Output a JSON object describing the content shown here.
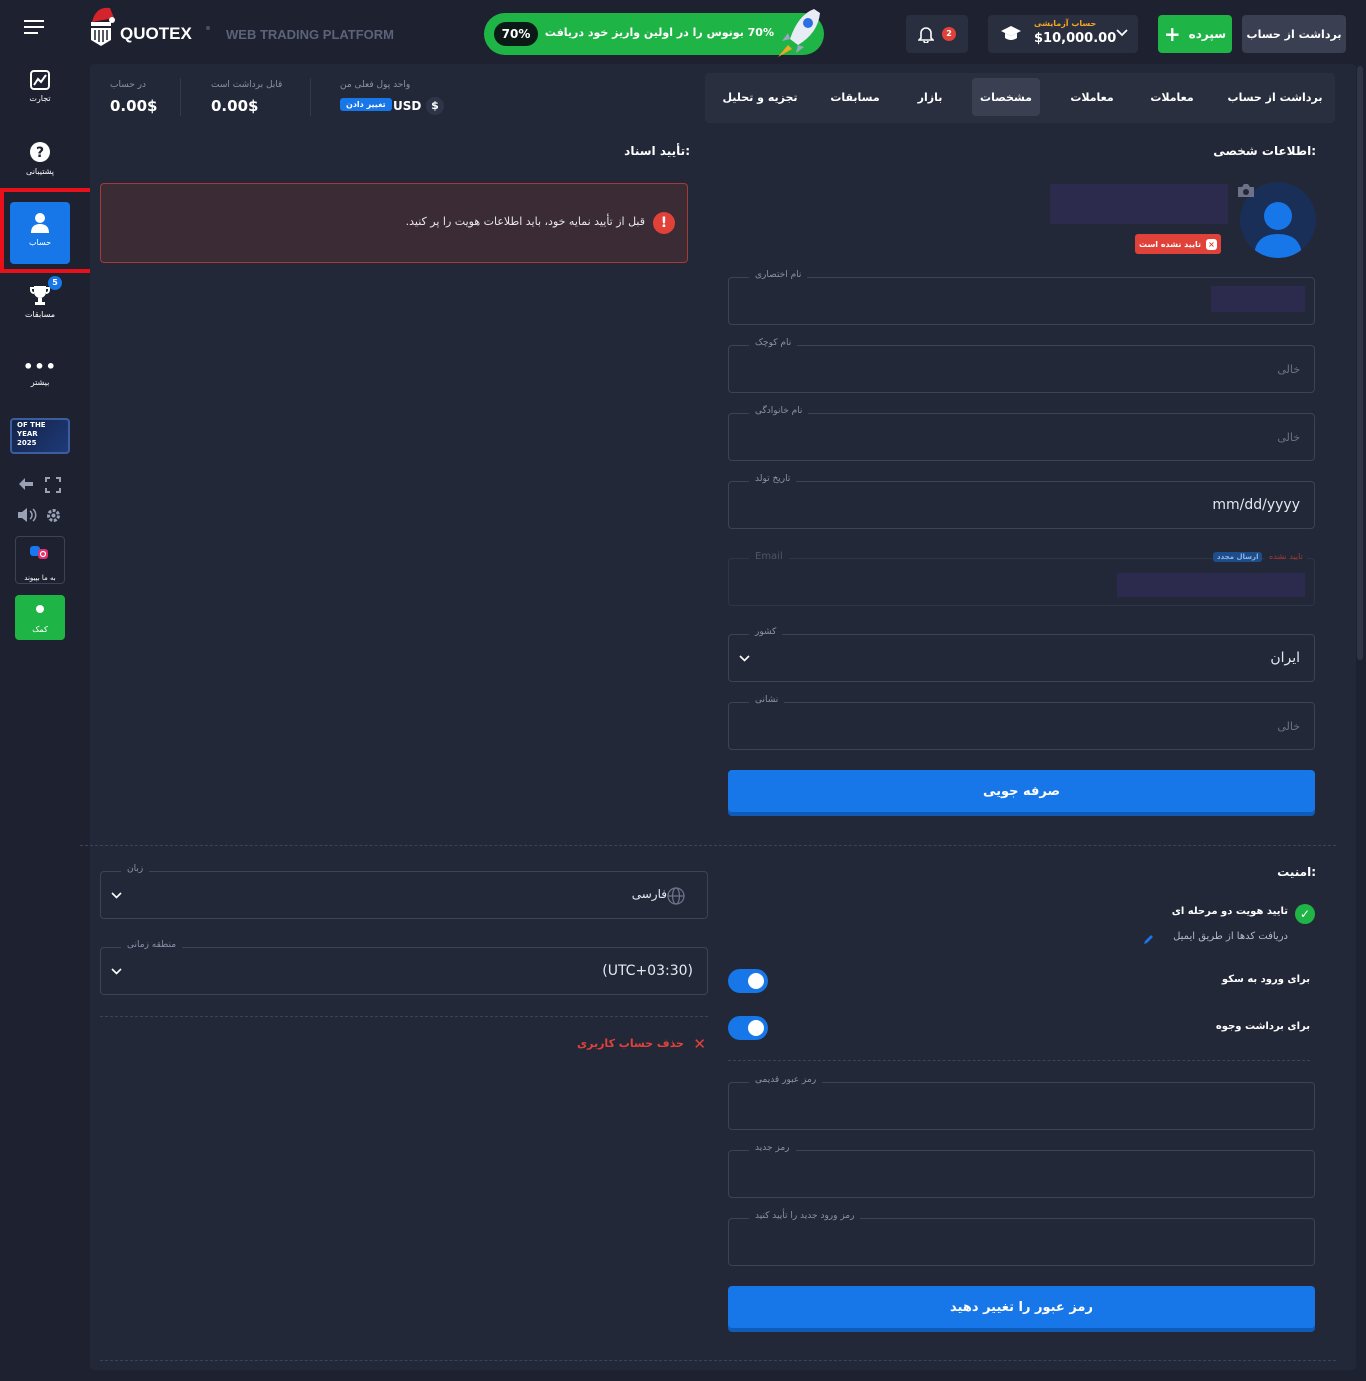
{
  "sidebar": {
    "items": [
      {
        "label": "تجارت",
        "icon": "chart-icon"
      },
      {
        "label": "پشتیبانی",
        "icon": "help-icon"
      },
      {
        "label": "حساب",
        "icon": "user-icon"
      },
      {
        "label": "مسابقات",
        "icon": "trophy-icon",
        "badge": "5"
      },
      {
        "label": "بیشتر",
        "icon": "more-icon"
      }
    ],
    "award_text": "OF THE YEAR 2025",
    "social_label": "به ما بپیوند",
    "help_label": "کمک"
  },
  "header": {
    "brand": "QUOTEX",
    "subtitle": "WEB TRADING PLATFORM",
    "promo_badge": "70%",
    "promo_text": "70% بونوس را در اولین واریز خود دریافت کنید!",
    "notifications_count": "2",
    "account_type": "حساب آزمایشی",
    "balance": "$10,000.00",
    "deposit_label": "سپرده",
    "withdraw_label": "برداشت از حساب"
  },
  "stats": {
    "in_account_label": "در حساب",
    "in_account_value": "0.00$",
    "withdrawable_label": "قابل برداشت است",
    "withdrawable_value": "0.00$",
    "currency_label": "واحد پول فعلی من",
    "currency_symbol": "$",
    "currency_code": "USD",
    "change_label": "تغییر دادن"
  },
  "tabs": [
    "برداشت از حساب",
    "معاملات",
    "معاملات",
    "مشخصات",
    "بازار",
    "مسابقات",
    "تجزیه و تحلیل"
  ],
  "active_tab": "مشخصات",
  "personal": {
    "title": "اطلاعات شخصی:",
    "unverified": "تایید نشده است",
    "nickname_label": "نام اختصاری",
    "first_name_label": "نام کوچک",
    "first_name_placeholder": "خالی",
    "last_name_label": "نام خانوادگی",
    "last_name_placeholder": "خالی",
    "dob_label": "تاریخ تولد",
    "dob_value": "mm/dd/yyyy",
    "email_label": "Email",
    "email_status": "تایید نشده",
    "email_resend": "ارسال مجدد",
    "country_label": "کشور",
    "country_value": "ایران",
    "address_label": "نشانی",
    "address_placeholder": "خالی",
    "save_label": "صرفه جویی"
  },
  "documents": {
    "title": "تأیید اسناد:",
    "warning": "قبل از تأیید نمایه خود، باید اطلاعات هویت را پر کنید."
  },
  "settings": {
    "language_label": "زبان",
    "language_value": "فارسی",
    "timezone_label": "منطقه زمانی",
    "timezone_value": "(UTC+03:30)",
    "delete_label": "حذف حساب کاربری"
  },
  "security": {
    "title": "امنیت:",
    "twofa_label": "تایید هویت دو مرحله ای",
    "twofa_sub": "دریافت کدها از طریق ایمیل",
    "login_label": "برای ورود به سکو",
    "withdraw_label": "برای برداشت وجوه",
    "old_pw_label": "رمز عبور قدیمی",
    "new_pw_label": "رمز جدید",
    "confirm_pw_label": "رمز ورود جدید را تأیید کنید",
    "change_pw_label": "رمز عبور را تغییر دهید"
  },
  "colors": {
    "accent": "#1776e8",
    "green": "#1fb546",
    "danger": "#e0423a",
    "bg": "#1d2130",
    "panel": "#232838"
  }
}
